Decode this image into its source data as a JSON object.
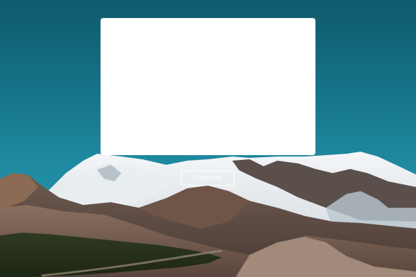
{
  "hero": {
    "background": "mountain-landscape-photo",
    "sky_color": "#17758a",
    "card_color": "#ffffff"
  },
  "cta": {
    "label": "Contact us"
  }
}
